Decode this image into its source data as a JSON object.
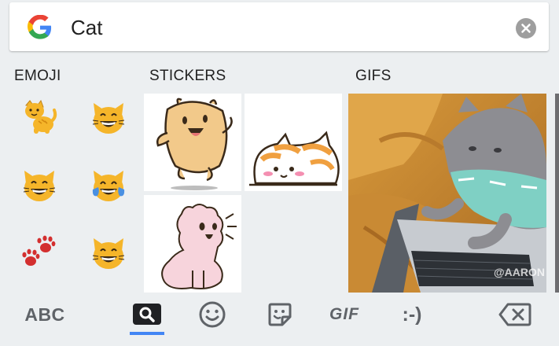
{
  "search": {
    "query": "Cat"
  },
  "sections": {
    "emoji_label": "EMOJI",
    "stickers_label": "STICKERS",
    "gifs_label": "GIFS"
  },
  "emoji": [
    {
      "icon": "cat-icon"
    },
    {
      "icon": "grinning-cat-icon"
    },
    {
      "icon": "grinning-cat-icon"
    },
    {
      "icon": "cat-tears-of-joy-icon"
    },
    {
      "icon": "paw-prints-icon"
    },
    {
      "icon": "grinning-cat-icon"
    }
  ],
  "gif": {
    "watermark": "@AARON"
  },
  "bottom_bar": {
    "abc_label": "ABC",
    "gif_label": "GIF",
    "emoticon_label": ":-)",
    "active_tab": "search"
  },
  "colors": {
    "background": "#eceff1",
    "accent": "#4285f4",
    "icon_gray": "#5f6368",
    "emoji_yellow": "#f5b52a"
  }
}
